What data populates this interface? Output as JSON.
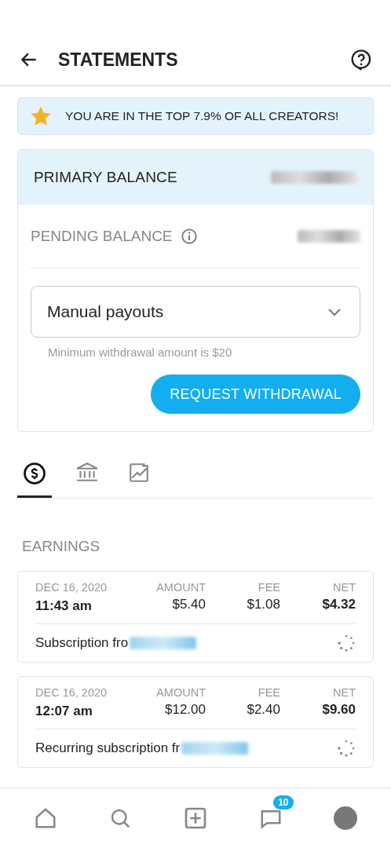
{
  "header": {
    "title": "STATEMENTS"
  },
  "banner": {
    "text": "YOU ARE IN THE TOP 7.9% OF ALL CREATORS!"
  },
  "balance": {
    "primary_label": "PRIMARY BALANCE",
    "pending_label": "PENDING BALANCE",
    "payout_select": {
      "value": "Manual payouts"
    },
    "hint": "Minimum withdrawal amount is $20",
    "button": "REQUEST WITHDRAWAL"
  },
  "tabs": [
    {
      "kind": "earnings",
      "selected": true
    },
    {
      "kind": "bank",
      "selected": false
    },
    {
      "kind": "stats",
      "selected": false
    }
  ],
  "section_title": "EARNINGS",
  "earnings": [
    {
      "date": "DEC 16, 2020",
      "time": "11:43 am",
      "amount_label": "AMOUNT",
      "amount": "$5.40",
      "fee_label": "FEE",
      "fee": "$1.08",
      "net_label": "NET",
      "net": "$4.32",
      "description": "Subscription fro"
    },
    {
      "date": "DEC 16, 2020",
      "time": "12:07 am",
      "amount_label": "AMOUNT",
      "amount": "$12.00",
      "fee_label": "FEE",
      "fee": "$2.40",
      "net_label": "NET",
      "net": "$9.60",
      "description": "Recurring subscription fr"
    }
  ],
  "bottom_nav": {
    "messages_badge": "10"
  }
}
